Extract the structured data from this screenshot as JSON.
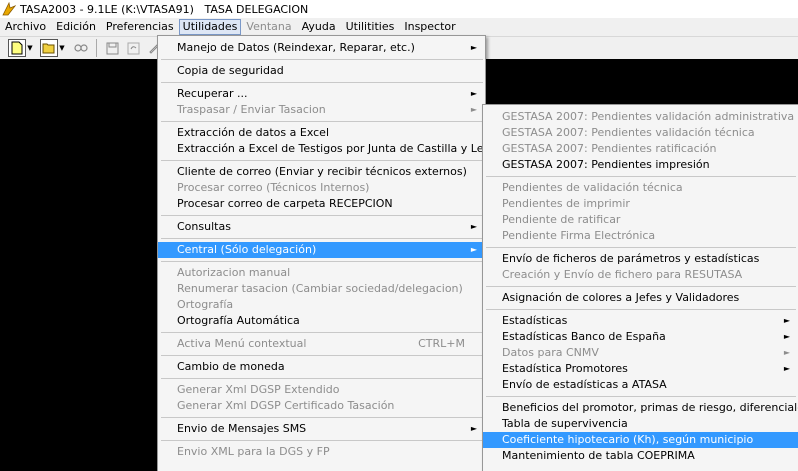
{
  "window": {
    "title": "TASA2003 - 9.1LE (K:\\VTASA91)   TASA DELEGACION"
  },
  "menubar": [
    {
      "label": "Archivo",
      "state": "normal"
    },
    {
      "label": "Edición",
      "state": "normal"
    },
    {
      "label": "Preferencias",
      "state": "normal"
    },
    {
      "label": "Utilidades",
      "state": "active"
    },
    {
      "label": "Ventana",
      "state": "disabled"
    },
    {
      "label": "Ayuda",
      "state": "normal"
    },
    {
      "label": "Utilitities",
      "state": "normal"
    },
    {
      "label": "Inspector",
      "state": "normal"
    }
  ],
  "utilidades_menu": [
    {
      "label": "Manejo de Datos (Reindexar, Reparar, etc.)",
      "arrow": true
    },
    {
      "sep": true
    },
    {
      "label": "Copia de seguridad"
    },
    {
      "sep": true
    },
    {
      "label": "Recuperar ...",
      "arrow": true
    },
    {
      "label": "Traspasar / Enviar Tasacion",
      "disabled": true,
      "arrow": true
    },
    {
      "sep": true
    },
    {
      "label": "Extracción de datos a Excel"
    },
    {
      "label": "Extracción a Excel de Testigos por Junta de Castilla y León"
    },
    {
      "sep": true
    },
    {
      "label": "Cliente de correo (Enviar y recibir técnicos externos)"
    },
    {
      "label": "Procesar correo (Técnicos Internos)",
      "disabled": true
    },
    {
      "label": "Procesar correo de carpeta RECEPCION"
    },
    {
      "sep": true
    },
    {
      "label": "Consultas",
      "arrow": true
    },
    {
      "sep": true
    },
    {
      "label": "Central  (Sólo delegación)",
      "arrow": true,
      "highlight": true
    },
    {
      "sep": true
    },
    {
      "label": "Autorizacion manual",
      "disabled": true
    },
    {
      "label": "Renumerar tasacion (Cambiar sociedad/delegacion)",
      "disabled": true
    },
    {
      "label": "Ortografía",
      "disabled": true
    },
    {
      "label": "Ortografía Automática"
    },
    {
      "sep": true
    },
    {
      "label": "Activa Menú contextual",
      "disabled": true,
      "shortcut": "CTRL+M"
    },
    {
      "sep": true
    },
    {
      "label": "Cambio de moneda"
    },
    {
      "sep": true
    },
    {
      "label": "Generar Xml DGSP Extendido",
      "disabled": true
    },
    {
      "label": "Generar Xml DGSP Certificado Tasación",
      "disabled": true
    },
    {
      "sep": true
    },
    {
      "label": "Envio de Mensajes SMS",
      "arrow": true
    },
    {
      "sep": true
    },
    {
      "label": "Envio XML para la DGS y FP",
      "disabled": true
    }
  ],
  "central_submenu": [
    {
      "label": "GESTASA 2007: Pendientes validación administrativa",
      "disabled": true
    },
    {
      "label": "GESTASA 2007: Pendientes validación técnica",
      "disabled": true
    },
    {
      "label": "GESTASA 2007: Pendientes ratificación",
      "disabled": true
    },
    {
      "label": "GESTASA 2007: Pendientes impresión"
    },
    {
      "sep": true
    },
    {
      "label": "Pendientes de validación técnica",
      "disabled": true
    },
    {
      "label": "Pendientes de imprimir",
      "disabled": true
    },
    {
      "label": "Pendiente de ratificar",
      "disabled": true
    },
    {
      "label": "Pendiente Firma Electrónica",
      "disabled": true
    },
    {
      "sep": true
    },
    {
      "label": "Envío de ficheros de parámetros y estadísticas"
    },
    {
      "label": "Creación y Envío de fichero para RESUTASA",
      "disabled": true
    },
    {
      "sep": true
    },
    {
      "label": "Asignación de colores a Jefes y Validadores"
    },
    {
      "sep": true
    },
    {
      "label": "Estadísticas",
      "arrow": true
    },
    {
      "label": "Estadísticas Banco de España",
      "arrow": true
    },
    {
      "label": "Datos para CNMV",
      "disabled": true,
      "arrow": true
    },
    {
      "label": "Estadística Promotores",
      "arrow": true
    },
    {
      "label": "Envío de estadísticas a ATASA"
    },
    {
      "sep": true
    },
    {
      "label": "Beneficios del promotor, primas de riesgo, diferenciales"
    },
    {
      "label": "Tabla de supervivencia"
    },
    {
      "label": "Coeficiente hipotecario (Kh), según municipio",
      "highlight": true
    },
    {
      "label": "Mantenimiento de tabla COEPRIMA"
    }
  ]
}
